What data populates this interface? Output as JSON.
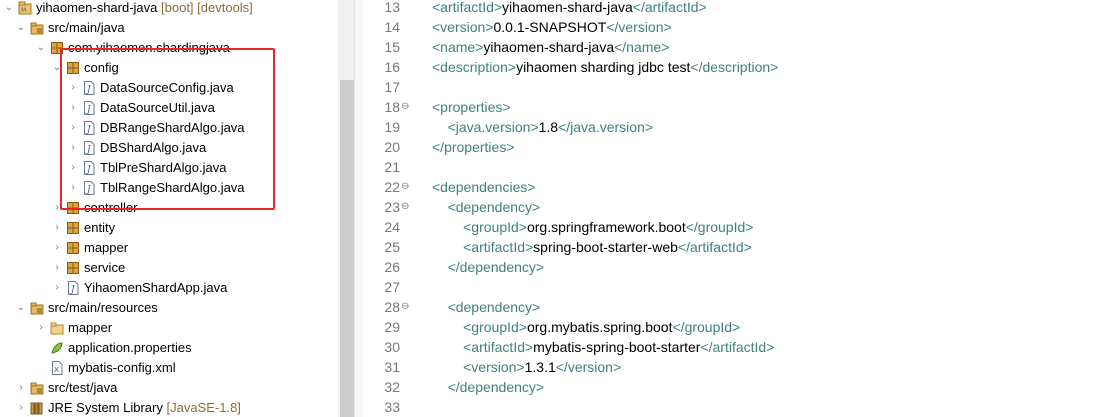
{
  "explorer": {
    "rows": [
      {
        "label": "yihaomen-shard-java",
        "decoration": " [boot] [devtools]",
        "icon": "project-icon",
        "expanded": true
      },
      {
        "label": "src/main/java",
        "icon": "source-folder-icon",
        "expanded": true
      },
      {
        "label": "com.yihaomen.shardingjava",
        "icon": "package-icon",
        "expanded": true
      },
      {
        "label": "config",
        "icon": "package-icon",
        "expanded": true
      },
      {
        "label": "DataSourceConfig.java",
        "icon": "java-file-icon",
        "expanded": false
      },
      {
        "label": "DataSourceUtil.java",
        "icon": "java-file-icon",
        "expanded": false
      },
      {
        "label": "DBRangeShardAlgo.java",
        "icon": "java-file-icon",
        "expanded": false
      },
      {
        "label": "DBShardAlgo.java",
        "icon": "java-file-icon",
        "expanded": false
      },
      {
        "label": "TblPreShardAlgo.java",
        "icon": "java-file-icon",
        "expanded": false
      },
      {
        "label": "TblRangeShardAlgo.java",
        "icon": "java-file-icon",
        "expanded": false
      },
      {
        "label": "controller",
        "icon": "package-icon",
        "expanded": false
      },
      {
        "label": "entity",
        "icon": "package-icon",
        "expanded": false
      },
      {
        "label": "mapper",
        "icon": "package-icon",
        "expanded": false
      },
      {
        "label": "service",
        "icon": "package-icon",
        "expanded": false
      },
      {
        "label": "YihaomenShardApp.java",
        "icon": "java-file-icon",
        "expanded": false
      },
      {
        "label": "src/main/resources",
        "icon": "source-folder-icon",
        "expanded": true
      },
      {
        "label": "mapper",
        "icon": "folder-icon",
        "expanded": false
      },
      {
        "label": "application.properties",
        "icon": "properties-file-icon",
        "expanded": false
      },
      {
        "label": "mybatis-config.xml",
        "icon": "xml-file-icon",
        "expanded": false
      },
      {
        "label": "src/test/java",
        "icon": "source-folder-icon",
        "expanded": false
      },
      {
        "label": "JRE System Library",
        "decoration": " [JavaSE-1.8]",
        "icon": "library-icon",
        "expanded": false
      }
    ]
  },
  "editor": {
    "lines": [
      {
        "num": "13",
        "fold": "",
        "tokens": [
          {
            "t": "tag",
            "v": "<artifactId>"
          },
          {
            "t": "txt",
            "v": "yihaomen-shard-java"
          },
          {
            "t": "tag",
            "v": "</artifactId>"
          }
        ]
      },
      {
        "num": "14",
        "fold": "",
        "tokens": [
          {
            "t": "tag",
            "v": "<version>"
          },
          {
            "t": "txt",
            "v": "0.0.1-SNAPSHOT"
          },
          {
            "t": "tag",
            "v": "</version>"
          }
        ]
      },
      {
        "num": "15",
        "fold": "",
        "tokens": [
          {
            "t": "tag",
            "v": "<name>"
          },
          {
            "t": "txt",
            "v": "yihaomen-shard-java"
          },
          {
            "t": "tag",
            "v": "</name>"
          }
        ]
      },
      {
        "num": "16",
        "fold": "",
        "tokens": [
          {
            "t": "tag",
            "v": "<description>"
          },
          {
            "t": "txt",
            "v": "yihaomen sharding jdbc test"
          },
          {
            "t": "tag",
            "v": "</description>"
          }
        ]
      },
      {
        "num": "17",
        "fold": "",
        "tokens": []
      },
      {
        "num": "18",
        "fold": "⊖",
        "tokens": [
          {
            "t": "tag",
            "v": "<properties>"
          }
        ]
      },
      {
        "num": "19",
        "fold": "",
        "tokens": [
          {
            "t": "ws",
            "v": "    "
          },
          {
            "t": "tag",
            "v": "<java.version>"
          },
          {
            "t": "txt",
            "v": "1.8"
          },
          {
            "t": "tag",
            "v": "</java.version>"
          }
        ]
      },
      {
        "num": "20",
        "fold": "",
        "tokens": [
          {
            "t": "tag",
            "v": "</properties>"
          }
        ]
      },
      {
        "num": "21",
        "fold": "",
        "tokens": []
      },
      {
        "num": "22",
        "fold": "⊖",
        "tokens": [
          {
            "t": "tag",
            "v": "<dependencies>"
          }
        ]
      },
      {
        "num": "23",
        "fold": "⊖",
        "tokens": [
          {
            "t": "ws",
            "v": "    "
          },
          {
            "t": "tag",
            "v": "<dependency>"
          }
        ]
      },
      {
        "num": "24",
        "fold": "",
        "tokens": [
          {
            "t": "ws",
            "v": "        "
          },
          {
            "t": "tag",
            "v": "<groupId>"
          },
          {
            "t": "txt",
            "v": "org.springframework.boot"
          },
          {
            "t": "tag",
            "v": "</groupId>"
          }
        ]
      },
      {
        "num": "25",
        "fold": "",
        "tokens": [
          {
            "t": "ws",
            "v": "        "
          },
          {
            "t": "tag",
            "v": "<artifactId>"
          },
          {
            "t": "txt",
            "v": "spring-boot-starter-web"
          },
          {
            "t": "tag",
            "v": "</artifactId>"
          }
        ]
      },
      {
        "num": "26",
        "fold": "",
        "tokens": [
          {
            "t": "ws",
            "v": "    "
          },
          {
            "t": "tag",
            "v": "</dependency>"
          }
        ]
      },
      {
        "num": "27",
        "fold": "",
        "tokens": []
      },
      {
        "num": "28",
        "fold": "⊖",
        "tokens": [
          {
            "t": "ws",
            "v": "    "
          },
          {
            "t": "tag",
            "v": "<dependency>"
          }
        ]
      },
      {
        "num": "29",
        "fold": "",
        "tokens": [
          {
            "t": "ws",
            "v": "        "
          },
          {
            "t": "tag",
            "v": "<groupId>"
          },
          {
            "t": "txt",
            "v": "org.mybatis.spring.boot"
          },
          {
            "t": "tag",
            "v": "</groupId>"
          }
        ]
      },
      {
        "num": "30",
        "fold": "",
        "tokens": [
          {
            "t": "ws",
            "v": "        "
          },
          {
            "t": "tag",
            "v": "<artifactId>"
          },
          {
            "t": "txt",
            "v": "mybatis-spring-boot-starter"
          },
          {
            "t": "tag",
            "v": "</artifactId>"
          }
        ]
      },
      {
        "num": "31",
        "fold": "",
        "tokens": [
          {
            "t": "ws",
            "v": "        "
          },
          {
            "t": "tag",
            "v": "<version>"
          },
          {
            "t": "txt",
            "v": "1.3.1"
          },
          {
            "t": "tag",
            "v": "</version>"
          }
        ]
      },
      {
        "num": "32",
        "fold": "",
        "tokens": [
          {
            "t": "ws",
            "v": "    "
          },
          {
            "t": "tag",
            "v": "</dependency>"
          }
        ]
      },
      {
        "num": "33",
        "fold": "",
        "tokens": []
      }
    ]
  },
  "colors": {
    "tag": "#3f7f7f",
    "highlight": "#e8262b",
    "line_number": "#787878"
  }
}
